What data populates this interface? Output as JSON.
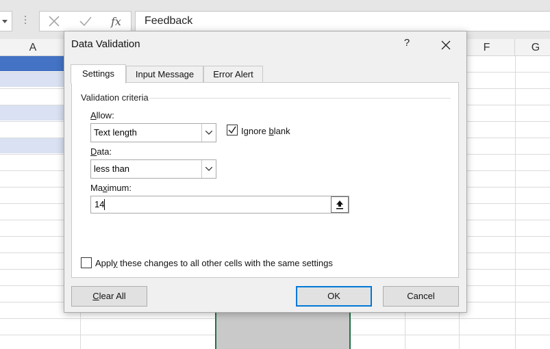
{
  "formula_bar": {
    "content": "Feedback",
    "cancel_icon": "x-icon",
    "enter_icon": "check-icon",
    "function_icon": "fx-icon"
  },
  "columns": {
    "a": "A",
    "f": "F",
    "g": "G"
  },
  "colors": {
    "header_selected": "#4472c4",
    "band": "#d9e1f2",
    "selection_border": "#217346",
    "accent": "#0078d7"
  },
  "dialog": {
    "title": "Data Validation",
    "help": "?",
    "tabs": [
      "Settings",
      "Input Message",
      "Error Alert"
    ],
    "active_tab": "Settings",
    "group_label": "Validation criteria",
    "allow": {
      "label_u": "A",
      "label_rest": "llow:",
      "value": "Text length"
    },
    "ignore_blank": {
      "checked": true,
      "label_pre": "Ignore ",
      "label_u": "b",
      "label_post": "lank"
    },
    "data": {
      "label_u": "D",
      "label_rest": "ata:",
      "value": "less than"
    },
    "maximum": {
      "label_pre": "Ma",
      "label_u": "x",
      "label_post": "imum:",
      "value": "14"
    },
    "apply_all": {
      "checked": false,
      "label_pre": "Appl",
      "label_u": "y",
      "label_post": " these changes to all other cells with the same settings"
    },
    "buttons": {
      "clear_u": "C",
      "clear_rest": "lear All",
      "ok": "OK",
      "cancel": "Cancel"
    }
  }
}
